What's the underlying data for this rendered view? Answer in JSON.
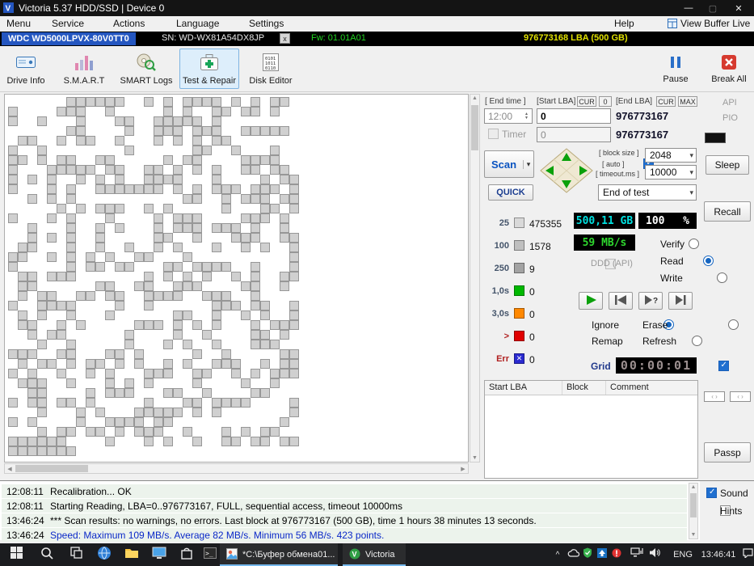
{
  "titlebar": {
    "title": "Victoria 5.37 HDD/SSD | Device 0"
  },
  "icons": {
    "minimize": "—",
    "maximize": "▢",
    "close": "✕",
    "dropdown": "▾",
    "up": "▲",
    "down": "▼",
    "left": "◀",
    "right": "▶",
    "tray_expand": "^",
    "close_small": "x"
  },
  "menubar": {
    "items": [
      "Menu",
      "Service",
      "Actions",
      "Language",
      "Settings"
    ],
    "help": "Help",
    "view_buffer_live": "View Buffer Live"
  },
  "drivebar": {
    "model": "WDC WD5000LPVX-80V0TT0",
    "model_bg": "#2456c0",
    "serial": "SN: WD-WX81A54DX8JP",
    "close": "x",
    "firmware": "Fw: 01.01A01",
    "firmware_color": "#21d421",
    "capacity": "976773168 LBA (500 GB)",
    "capacity_color": "#e0e000"
  },
  "toolbar": {
    "buttons": [
      "Drive Info",
      "S.M.A.R.T",
      "SMART Logs",
      "Test & Repair",
      "Disk Editor"
    ],
    "active": "Test & Repair",
    "pause": "Pause",
    "break_all": "Break All"
  },
  "scan_controls": {
    "end_time_label": "[ End time ]",
    "end_time": "12:00",
    "start_lba_label": "[Start LBA]",
    "cur": "CUR",
    "zero": "0",
    "end_lba_label": "[End LBA]",
    "max": "MAX",
    "start_lba": "0",
    "end_lba": "976773167",
    "timer_label": "Timer",
    "timer_value": "0",
    "timer_end_lba": "976773167",
    "scan": "Scan",
    "block_size_label": "[ block size ]",
    "auto_label": "[ auto ]",
    "block_size": "2048",
    "timeout_label": "[ timeout.ms ]",
    "timeout": "10000",
    "quick": "QUICK",
    "end_of_test": "End of test"
  },
  "latency_stats": [
    {
      "label": "25",
      "value": "475355",
      "color": "#d9d9d9",
      "mark": ""
    },
    {
      "label": "100",
      "value": "1578",
      "color": "#bfbfbf",
      "mark": ""
    },
    {
      "label": "250",
      "value": "9",
      "color": "#a3a3a3",
      "mark": ""
    },
    {
      "label": "1,0s",
      "value": "0",
      "color": "#00b800",
      "mark": ""
    },
    {
      "label": "3,0s",
      "value": "0",
      "color": "#ff8800",
      "mark": ""
    },
    {
      "label": ">",
      "value": "0",
      "color": "#e00000",
      "mark": ""
    },
    {
      "label": "Err",
      "value": "0",
      "color": "#2a2ad0",
      "mark": "✕"
    }
  ],
  "readouts": {
    "size": "500,11 GB",
    "size_color": "#00e0e0",
    "percent": "100",
    "percent_sign": "%",
    "percent_color": "#ffffff",
    "speed": "59 MB/s",
    "speed_color": "#2ed82e"
  },
  "mode": {
    "ddd": "DDD (API)",
    "verify": "Verify",
    "read": "Read",
    "write": "Write",
    "selected": "Read"
  },
  "repair": {
    "ignore": "Ignore",
    "erase": "Erase",
    "remap": "Remap",
    "refresh": "Refresh",
    "selected": "Ignore"
  },
  "grid_row": {
    "label": "Grid",
    "clock": "00:00:01",
    "clock_color": "#9b8f8f"
  },
  "results_table": {
    "headers": [
      "Start LBA",
      "Block",
      "Comment"
    ],
    "rows": []
  },
  "side_panel": {
    "api": "API",
    "pio": "PIO",
    "sleep": "Sleep",
    "recall": "Recall",
    "passp": "Passp"
  },
  "log": {
    "lines": [
      {
        "time": "12:08:11",
        "text": "Recalibration... OK",
        "color": "#000000"
      },
      {
        "time": "12:08:11",
        "text": "Starting Reading, LBA=0..976773167, FULL, sequential access, timeout 10000ms",
        "color": "#000000"
      },
      {
        "time": "13:46:24",
        "text": "*** Scan results: no warnings, no errors. Last block at 976773167 (500 GB), time 1 hours 38 minutes 13 seconds.",
        "color": "#000000"
      },
      {
        "time": "13:46:24",
        "text": "Speed: Maximum 109 MB/s. Average 82 MB/s. Minimum 56 MB/s. 423 points.",
        "color": "#0a28c8"
      }
    ],
    "sound": "Sound",
    "hints": "Hints"
  },
  "taskbar": {
    "windows": [
      {
        "label": "*C:\\Буфер обмена01..."
      },
      {
        "label": "Victoria"
      }
    ],
    "lang": "ENG",
    "time": "13:46:41"
  },
  "scan_map": {
    "cols": 30,
    "rows": 36,
    "density": 0.42,
    "seed": 1234567,
    "tail_cells": 7,
    "filled_color": "#d0d0d0",
    "border_color": "#979797"
  }
}
